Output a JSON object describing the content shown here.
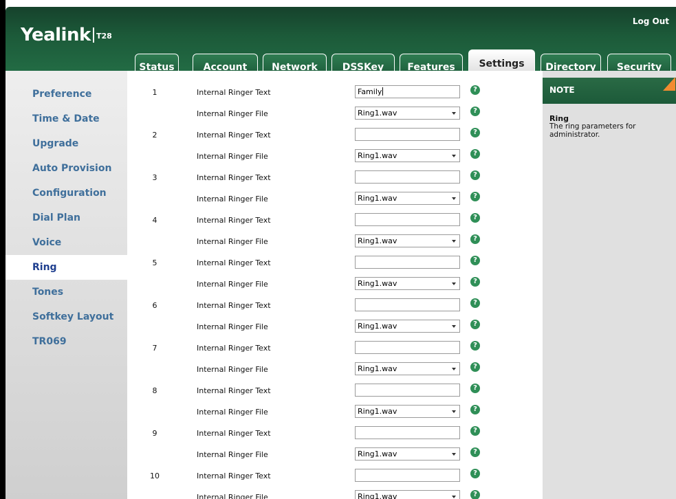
{
  "header": {
    "logo_text": "Yealink",
    "model": "T28",
    "logout_label": "Log Out"
  },
  "tabs": [
    {
      "label": "Status"
    },
    {
      "label": "Account"
    },
    {
      "label": "Network"
    },
    {
      "label": "DSSKey"
    },
    {
      "label": "Features"
    },
    {
      "label": "Settings",
      "active": true
    },
    {
      "label": "Directory"
    },
    {
      "label": "Security"
    }
  ],
  "sidebar": {
    "items": [
      {
        "label": "Preference"
      },
      {
        "label": "Time & Date"
      },
      {
        "label": "Upgrade"
      },
      {
        "label": "Auto Provision"
      },
      {
        "label": "Configuration"
      },
      {
        "label": "Dial Plan"
      },
      {
        "label": "Voice"
      },
      {
        "label": "Ring",
        "active": true
      },
      {
        "label": "Tones"
      },
      {
        "label": "Softkey Layout"
      },
      {
        "label": "TR069"
      }
    ]
  },
  "ring_settings": {
    "text_label": "Internal Ringer Text",
    "file_label": "Internal Ringer File",
    "help_symbol": "?",
    "rows": [
      {
        "index": "1",
        "text_value": "Family",
        "file_value": "Ring1.wav"
      },
      {
        "index": "2",
        "text_value": "",
        "file_value": "Ring1.wav"
      },
      {
        "index": "3",
        "text_value": "",
        "file_value": "Ring1.wav"
      },
      {
        "index": "4",
        "text_value": "",
        "file_value": "Ring1.wav"
      },
      {
        "index": "5",
        "text_value": "",
        "file_value": "Ring1.wav"
      },
      {
        "index": "6",
        "text_value": "",
        "file_value": "Ring1.wav"
      },
      {
        "index": "7",
        "text_value": "",
        "file_value": "Ring1.wav"
      },
      {
        "index": "8",
        "text_value": "",
        "file_value": "Ring1.wav"
      },
      {
        "index": "9",
        "text_value": "",
        "file_value": "Ring1.wav"
      },
      {
        "index": "10",
        "text_value": "",
        "file_value": "Ring1.wav"
      }
    ]
  },
  "note": {
    "title": "NOTE",
    "heading": "Ring",
    "description": "The ring parameters for administrator."
  },
  "colors": {
    "header_green": "#1c5a39",
    "sidebar_link": "#3f6f9b",
    "help_icon": "#2f8f57",
    "note_corner": "#f28b30"
  }
}
